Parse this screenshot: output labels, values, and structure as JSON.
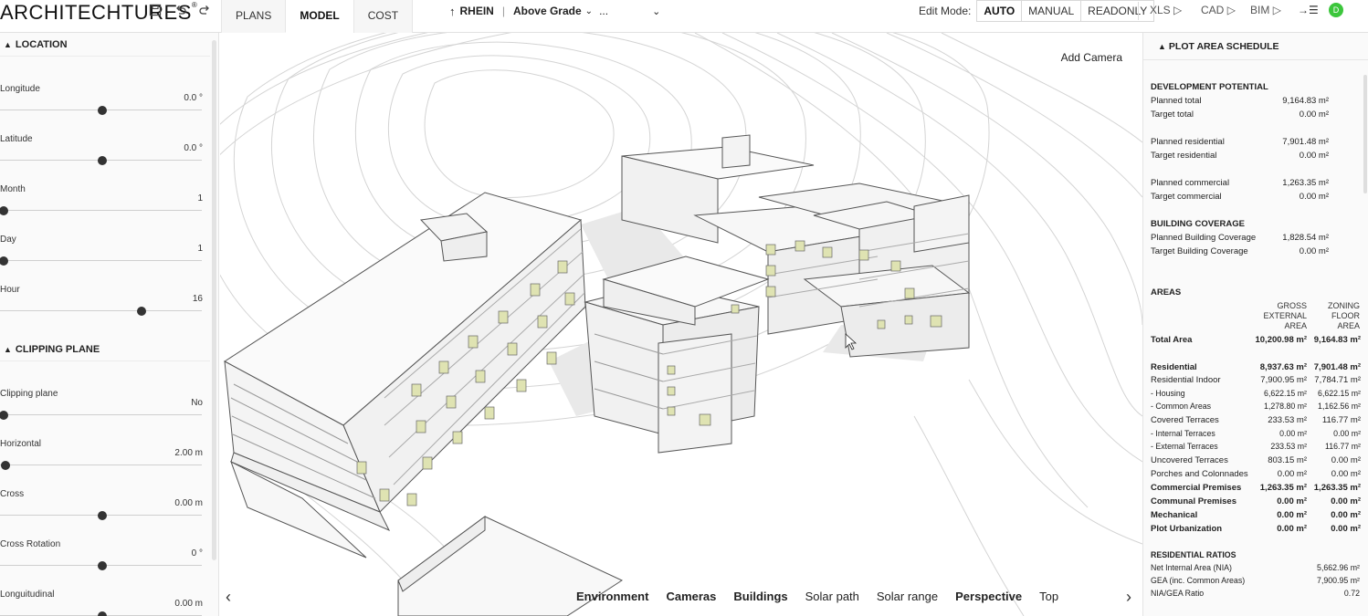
{
  "header": {
    "logo": "ARCHITECHTURES",
    "logo_mark": "®",
    "tabs": [
      {
        "label": "PLANS",
        "active": false
      },
      {
        "label": "MODEL",
        "active": true
      },
      {
        "label": "COST",
        "active": false
      }
    ],
    "project": {
      "name": "RHEIN",
      "level": "Above Grade",
      "more": "..."
    },
    "edit_mode": {
      "label": "Edit Mode:",
      "options": [
        "AUTO",
        "MANUAL",
        "READONLY"
      ],
      "selected": "AUTO"
    },
    "exports": [
      "XLS",
      "CAD",
      "BIM"
    ],
    "avatar": "D",
    "icons": [
      "save-icon",
      "undo-icon",
      "redo-icon",
      "north-arrow-icon",
      "export-list-icon"
    ]
  },
  "left_panel": {
    "location": {
      "title": "LOCATION",
      "controls": [
        {
          "label": "Longitude",
          "value": "0.0 °",
          "position": 0.5
        },
        {
          "label": "Latitude",
          "value": "0.0 °",
          "position": 0.5
        },
        {
          "label": "Month",
          "value": "1",
          "position": 0.0
        },
        {
          "label": "Day",
          "value": "1",
          "position": 0.0
        },
        {
          "label": "Hour",
          "value": "16",
          "position": 0.7
        }
      ]
    },
    "clipping": {
      "title": "CLIPPING PLANE",
      "controls": [
        {
          "label": "Clipping plane",
          "value": "No",
          "position": 0.0
        },
        {
          "label": "Horizontal",
          "value": "2.00 m",
          "position": 0.01
        },
        {
          "label": "Cross",
          "value": "0.00 m",
          "position": 0.5
        },
        {
          "label": "Cross Rotation",
          "value": "0 °",
          "position": 0.5
        },
        {
          "label": "Longuitudinal",
          "value": "0.00 m",
          "position": 0.5
        }
      ]
    }
  },
  "viewport": {
    "add_camera": "Add Camera",
    "tabs": [
      {
        "label": "Environment",
        "bold": true
      },
      {
        "label": "Cameras",
        "bold": true
      },
      {
        "label": "Buildings",
        "bold": true
      },
      {
        "label": "Solar path",
        "bold": false
      },
      {
        "label": "Solar range",
        "bold": false
      },
      {
        "label": "Perspective",
        "bold": true
      },
      {
        "label": "Top",
        "bold": false
      }
    ]
  },
  "right_panel": {
    "title": "PLOT AREA SCHEDULE",
    "development_potential": {
      "title": "DEVELOPMENT POTENTIAL",
      "rows": [
        {
          "label": "Planned total",
          "value": "9,164.83 m²"
        },
        {
          "label": "Target total",
          "value": "0.00 m²"
        },
        {
          "label": "Planned residential",
          "value": "7,901.48 m²"
        },
        {
          "label": "Target residential",
          "value": "0.00 m²"
        },
        {
          "label": "Planned commercial",
          "value": "1,263.35 m²"
        },
        {
          "label": "Target commercial",
          "value": "0.00 m²"
        }
      ]
    },
    "building_coverage": {
      "title": "BUILDING COVERAGE",
      "rows": [
        {
          "label": "Planned Building Coverage",
          "value": "1,828.54 m²"
        },
        {
          "label": "Target Building Coverage",
          "value": "0.00 m²"
        }
      ]
    },
    "areas": {
      "title": "AREAS",
      "col_gross": [
        "GROSS",
        "EXTERNAL",
        "AREA"
      ],
      "col_zoning": [
        "ZONING",
        "FLOOR",
        "AREA"
      ],
      "rows": [
        {
          "label": "Total Area",
          "gross": "10,200.98 m²",
          "zoning": "9,164.83 m²",
          "style": "bold"
        },
        {
          "label": "Residential",
          "gross": "8,937.63 m²",
          "zoning": "7,901.48 m²",
          "style": "bold"
        },
        {
          "label": "Residential Indoor",
          "gross": "7,900.95 m²",
          "zoning": "7,784.71 m²",
          "style": "normal"
        },
        {
          "label": "- Housing",
          "gross": "6,622.15 m²",
          "zoning": "6,622.15 m²",
          "style": "small"
        },
        {
          "label": "- Common Areas",
          "gross": "1,278.80 m²",
          "zoning": "1,162.56 m²",
          "style": "small"
        },
        {
          "label": "Covered Terraces",
          "gross": "233.53 m²",
          "zoning": "116.77 m²",
          "style": "normal"
        },
        {
          "label": "- Internal Terraces",
          "gross": "0.00 m²",
          "zoning": "0.00 m²",
          "style": "small"
        },
        {
          "label": "- External Terraces",
          "gross": "233.53 m²",
          "zoning": "116.77 m²",
          "style": "small"
        },
        {
          "label": "Uncovered Terraces",
          "gross": "803.15 m²",
          "zoning": "0.00 m²",
          "style": "normal"
        },
        {
          "label": "Porches and Colonnades",
          "gross": "0.00 m²",
          "zoning": "0.00 m²",
          "style": "normal"
        },
        {
          "label": "Commercial Premises",
          "gross": "1,263.35 m²",
          "zoning": "1,263.35 m²",
          "style": "bold"
        },
        {
          "label": "Communal Premises",
          "gross": "0.00 m²",
          "zoning": "0.00 m²",
          "style": "bold"
        },
        {
          "label": "Mechanical",
          "gross": "0.00 m²",
          "zoning": "0.00 m²",
          "style": "bold"
        },
        {
          "label": "Plot Urbanization",
          "gross": "0.00 m²",
          "zoning": "0.00 m²",
          "style": "bold"
        }
      ]
    },
    "residential_ratios": {
      "title": "RESIDENTIAL RATIOS",
      "rows": [
        {
          "label": "Net Internal Area (NIA)",
          "value": "5,662.96 m²"
        },
        {
          "label": "GEA (inc. Common Areas)",
          "value": "7,900.95 m²"
        },
        {
          "label": "NIA/GEA Ratio",
          "value": "0.72"
        }
      ]
    }
  }
}
